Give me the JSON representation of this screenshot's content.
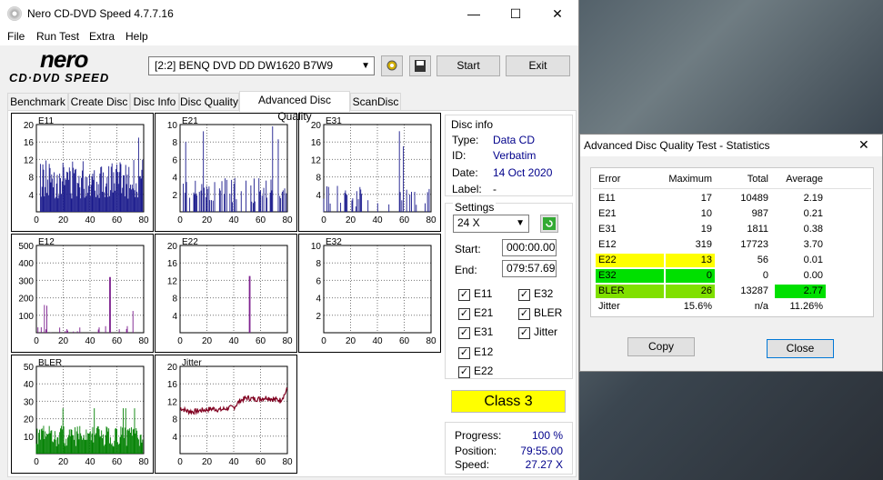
{
  "app": {
    "title": "Nero CD-DVD Speed 4.7.7.16",
    "logo_top": "nero",
    "logo_bottom": "CD·DVD SPEED"
  },
  "window_controls": {
    "minimize": "—",
    "maximize": "☐",
    "close": "✕"
  },
  "menu": [
    "File",
    "Run Test",
    "Extra",
    "Help"
  ],
  "drive": {
    "selected": "[2:2]   BENQ DVD DD DW1620 B7W9"
  },
  "buttons": {
    "start": "Start",
    "exit": "Exit"
  },
  "tabs": [
    "Benchmark",
    "Create Disc",
    "Disc Info",
    "Disc Quality",
    "Advanced Disc Quality",
    "ScanDisc"
  ],
  "active_tab": "Advanced Disc Quality",
  "disc_info": {
    "heading": "Disc info",
    "type_label": "Type:",
    "type": "Data CD",
    "id_label": "ID:",
    "id": "Verbatim",
    "date_label": "Date:",
    "date": "14 Oct 2020",
    "label_label": "Label:",
    "label": "-"
  },
  "settings": {
    "heading": "Settings",
    "speed": "24 X",
    "start_label": "Start:",
    "start": "000:00.00",
    "end_label": "End:",
    "end": "079:57.69"
  },
  "checkboxes": [
    {
      "label": "E11",
      "checked": true
    },
    {
      "label": "E32",
      "checked": true
    },
    {
      "label": "E21",
      "checked": true
    },
    {
      "label": "BLER",
      "checked": true
    },
    {
      "label": "E31",
      "checked": true
    },
    {
      "label": "Jitter",
      "checked": true
    },
    {
      "label": "E12",
      "checked": true
    },
    {
      "label": "E22",
      "checked": true
    }
  ],
  "class_result": "Class 3",
  "progress": {
    "progress_label": "Progress:",
    "progress": "100 %",
    "position_label": "Position:",
    "position": "79:55.00",
    "speed_label": "Speed:",
    "speed": "27.27 X"
  },
  "colors": {
    "e_series": "#1a1a8c",
    "e12_series": "#7a1a8c",
    "bler": "#008000",
    "jitter": "#800020",
    "class_bg": "#ffff00"
  },
  "chart_data": [
    {
      "type": "bar",
      "title": "E11",
      "x_ticks": [
        "0",
        "20",
        "40",
        "60",
        "80"
      ],
      "y_ticks": [
        "20",
        "16",
        "12",
        "8",
        "4"
      ],
      "ylim": [
        0,
        20
      ],
      "xlim": [
        0,
        80
      ],
      "typical_range": [
        3,
        12
      ],
      "peak": 17
    },
    {
      "type": "bar",
      "title": "E21",
      "x_ticks": [
        "0",
        "20",
        "40",
        "60",
        "80"
      ],
      "y_ticks": [
        "10",
        "8",
        "6",
        "4",
        "2"
      ],
      "ylim": [
        0,
        10
      ],
      "xlim": [
        0,
        80
      ],
      "typical_range": [
        0,
        4
      ],
      "peak": 10
    },
    {
      "type": "bar",
      "title": "E31",
      "x_ticks": [
        "0",
        "20",
        "40",
        "60",
        "80"
      ],
      "y_ticks": [
        "20",
        "16",
        "12",
        "8",
        "4"
      ],
      "ylim": [
        0,
        20
      ],
      "xlim": [
        0,
        80
      ],
      "typical_range": [
        0,
        6
      ],
      "peak": 19
    },
    {
      "type": "bar",
      "title": "E12",
      "x_ticks": [
        "0",
        "20",
        "40",
        "60",
        "80"
      ],
      "y_ticks": [
        "500",
        "400",
        "300",
        "200",
        "100"
      ],
      "ylim": [
        0,
        500
      ],
      "xlim": [
        0,
        80
      ],
      "typical_range": [
        0,
        40
      ],
      "peak": 319
    },
    {
      "type": "bar",
      "title": "E22",
      "x_ticks": [
        "0",
        "20",
        "40",
        "60",
        "80"
      ],
      "y_ticks": [
        "20",
        "16",
        "12",
        "8",
        "4"
      ],
      "ylim": [
        0,
        20
      ],
      "xlim": [
        0,
        80
      ],
      "spike_x": 52,
      "peak": 13
    },
    {
      "type": "bar",
      "title": "E32",
      "x_ticks": [
        "0",
        "20",
        "40",
        "60",
        "80"
      ],
      "y_ticks": [
        "10",
        "8",
        "6",
        "4",
        "2"
      ],
      "ylim": [
        0,
        10
      ],
      "xlim": [
        0,
        80
      ],
      "peak": 0
    },
    {
      "type": "bar",
      "title": "BLER",
      "x_ticks": [
        "0",
        "20",
        "40",
        "60",
        "80"
      ],
      "y_ticks": [
        "50",
        "40",
        "30",
        "20",
        "10"
      ],
      "ylim": [
        0,
        50
      ],
      "xlim": [
        0,
        80
      ],
      "typical_range": [
        4,
        16
      ],
      "peak": 26
    },
    {
      "type": "line",
      "title": "Jitter",
      "x_ticks": [
        "0",
        "20",
        "40",
        "60",
        "80"
      ],
      "y_ticks": [
        "20",
        "16",
        "12",
        "8",
        "4"
      ],
      "ylim": [
        0,
        20
      ],
      "xlim": [
        0,
        80
      ],
      "x": [
        0,
        5,
        10,
        15,
        20,
        25,
        30,
        35,
        40,
        45,
        50,
        55,
        60,
        65,
        70,
        75,
        78,
        80
      ],
      "y": [
        10.5,
        9.8,
        9.6,
        9.9,
        10.1,
        10.3,
        10.0,
        10.4,
        10.6,
        12.2,
        12.8,
        12.5,
        12.6,
        12.9,
        12.4,
        12.3,
        13.6,
        14.8
      ]
    }
  ],
  "stats_dialog": {
    "title": "Advanced Disc Quality Test - Statistics",
    "headers": [
      "Error",
      "Maximum",
      "Total",
      "Average"
    ],
    "rows": [
      {
        "name": "E11",
        "max": "17",
        "total": "10489",
        "avg": "2.19",
        "hl": ""
      },
      {
        "name": "E21",
        "max": "10",
        "total": "987",
        "avg": "0.21",
        "hl": ""
      },
      {
        "name": "E31",
        "max": "19",
        "total": "1811",
        "avg": "0.38",
        "hl": ""
      },
      {
        "name": "E12",
        "max": "319",
        "total": "17723",
        "avg": "3.70",
        "hl": ""
      },
      {
        "name": "E22",
        "max": "13",
        "total": "56",
        "avg": "0.01",
        "hl": "y"
      },
      {
        "name": "E32",
        "max": "0",
        "total": "0",
        "avg": "0.00",
        "hl": "g"
      },
      {
        "name": "BLER",
        "max": "26",
        "total": "13287",
        "avg": "2.77",
        "hl": "b"
      },
      {
        "name": "Jitter",
        "max": "15.6%",
        "total": "n/a",
        "avg": "11.26%",
        "hl": ""
      }
    ],
    "copy": "Copy",
    "close": "Close"
  }
}
